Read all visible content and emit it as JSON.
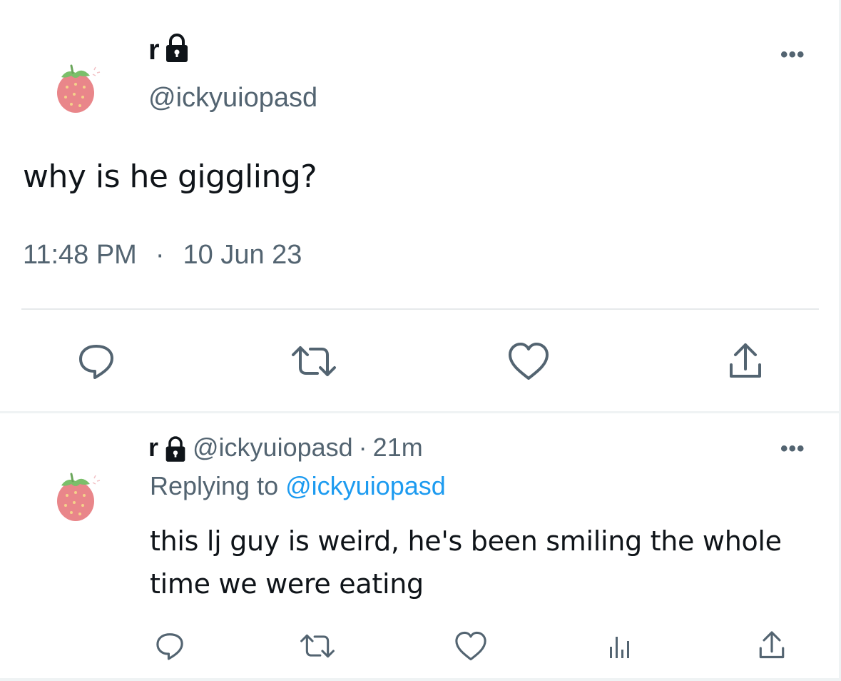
{
  "tweet": {
    "display_name": "r",
    "handle": "@ickyuiopasd",
    "text": "why is he giggling?",
    "time": "11:48 PM",
    "separator": "·",
    "date": "10 Jun 23",
    "more_label": "•••",
    "actions": [
      "reply-icon",
      "retweet-icon",
      "like-icon",
      "share-icon"
    ]
  },
  "reply": {
    "display_name": "r",
    "handle": "@ickyuiopasd",
    "dot": "·",
    "age": "21m",
    "replying_prefix": "Replying to",
    "replying_to": "@ickyuiopasd",
    "text": "this lj guy is weird, he's been smiling the whole time we were eating",
    "more_label": "•••",
    "actions": [
      "reply-icon",
      "retweet-icon",
      "like-icon",
      "views-icon",
      "share-icon"
    ]
  },
  "colors": {
    "text": "#0f1419",
    "muted": "#536471",
    "link": "#1d9bf0",
    "divider": "#e6e9eb",
    "strawberry": "#e9868a",
    "leaf": "#7bbf6a"
  }
}
